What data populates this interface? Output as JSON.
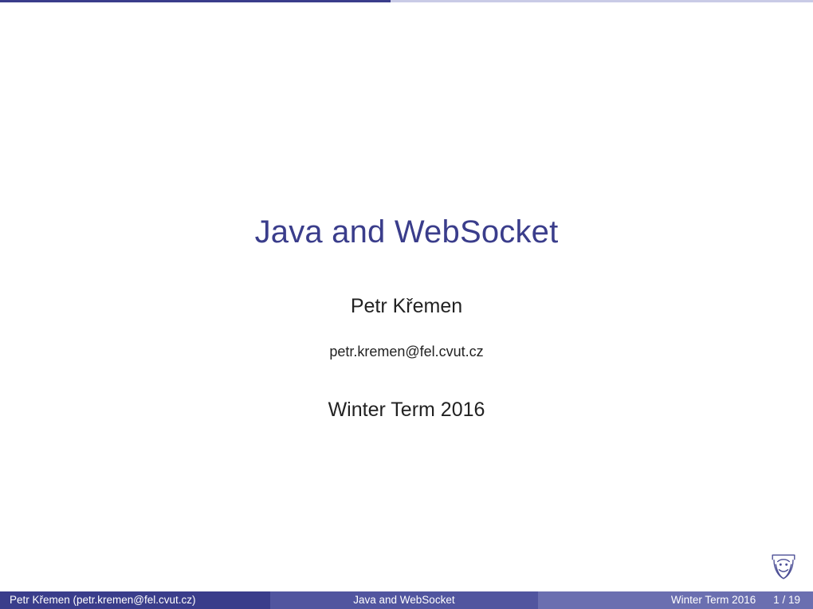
{
  "slide": {
    "title": "Java and WebSocket",
    "author": "Petr Křemen",
    "email": "petr.kremen@fel.cvut.cz",
    "term": "Winter Term 2016"
  },
  "footer": {
    "author_line": "Petr Křemen  (petr.kremen@fel.cvut.cz)",
    "title": "Java and WebSocket",
    "term": "Winter Term 2016",
    "page": "1 / 19"
  },
  "logo": {
    "name": "cvut-lion-logo",
    "color": "#3a3d8b"
  }
}
